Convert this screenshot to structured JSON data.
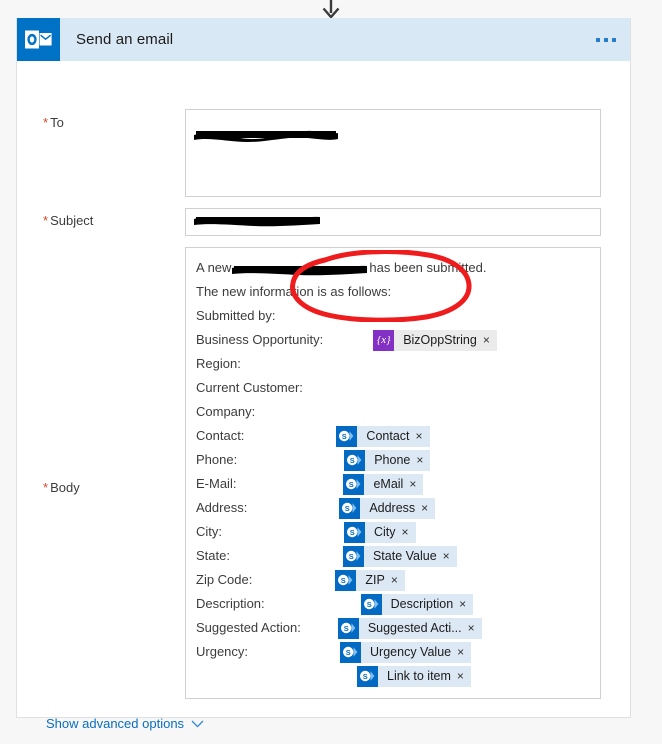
{
  "connector": {
    "icon": "arrow-down-icon"
  },
  "card": {
    "app_icon": "outlook-icon",
    "title": "Send an email",
    "menu_icon": "ellipsis-icon"
  },
  "fields": {
    "to": {
      "label": "To",
      "required": true,
      "value": "",
      "redacted": true
    },
    "subject": {
      "label": "Subject",
      "required": true,
      "value": "",
      "redacted": true
    },
    "body": {
      "label": "Body",
      "required": true
    }
  },
  "body_lines": [
    {
      "type": "text-redacted-text",
      "before": "A new",
      "after": "has been submitted."
    },
    {
      "type": "text",
      "text": "The new information is as follows:"
    },
    {
      "type": "text",
      "text": "Submitted by:"
    },
    {
      "type": "text-token",
      "label": "Business Opportunity:",
      "token": {
        "kind": "variable",
        "icon": "expression-icon",
        "glyph": "{x}",
        "name": "BizOppString",
        "remove": "×"
      },
      "indent": 118
    },
    {
      "type": "text",
      "text": "Region:"
    },
    {
      "type": "text",
      "text": "Current Customer:"
    },
    {
      "type": "text",
      "text": "Company:"
    },
    {
      "type": "text-token",
      "label": "Contact:",
      "token": {
        "kind": "sharepoint",
        "icon": "sharepoint-icon",
        "glyph": "S",
        "name": "Contact",
        "remove": "×"
      },
      "indent": 76
    },
    {
      "type": "text-token",
      "label": "Phone:",
      "token": {
        "kind": "sharepoint",
        "icon": "sharepoint-icon",
        "glyph": "S",
        "name": "Phone",
        "remove": "×"
      },
      "indent": 61
    },
    {
      "type": "text-token",
      "label": "E-Mail:",
      "token": {
        "kind": "sharepoint",
        "icon": "sharepoint-icon",
        "glyph": "S",
        "name": "eMail",
        "remove": "×"
      },
      "indent": 61
    },
    {
      "type": "text-token",
      "label": "Address:",
      "token": {
        "kind": "sharepoint",
        "icon": "sharepoint-icon",
        "glyph": "S",
        "name": "Address",
        "remove": "×"
      },
      "indent": 76
    },
    {
      "type": "text-token",
      "label": "City:",
      "token": {
        "kind": "sharepoint",
        "icon": "sharepoint-icon",
        "glyph": "S",
        "name": "City",
        "remove": "×"
      },
      "indent": 46
    },
    {
      "type": "text-token",
      "label": "State:",
      "token": {
        "kind": "sharepoint",
        "icon": "sharepoint-icon",
        "glyph": "S",
        "name": "State Value",
        "remove": "×"
      },
      "indent": 55
    },
    {
      "type": "text-token",
      "label": "Zip Code:",
      "token": {
        "kind": "sharepoint",
        "icon": "sharepoint-icon",
        "glyph": "S",
        "name": "ZIP",
        "remove": "×"
      },
      "indent": 85
    },
    {
      "type": "text-token",
      "label": "Description:",
      "token": {
        "kind": "sharepoint",
        "icon": "sharepoint-icon",
        "glyph": "S",
        "name": "Description",
        "remove": "×"
      },
      "indent": 72
    },
    {
      "type": "text-token",
      "label": "Suggested Action:",
      "token": {
        "kind": "sharepoint",
        "icon": "sharepoint-icon",
        "glyph": "S",
        "name": "Suggested Acti...",
        "remove": "×"
      },
      "indent": 131
    },
    {
      "type": "text-token",
      "label": "Urgency:",
      "token": {
        "kind": "sharepoint",
        "icon": "sharepoint-icon",
        "glyph": "S",
        "name": "Urgency Value",
        "remove": "×"
      },
      "indent": 76
    },
    {
      "type": "token-only",
      "label": "",
      "token": {
        "kind": "sharepoint",
        "icon": "sharepoint-icon",
        "glyph": "S",
        "name": "Link to item",
        "remove": "×"
      },
      "indent": 7
    }
  ],
  "footer": {
    "advanced_label": "Show advanced options",
    "chevron_icon": "chevron-down-icon"
  },
  "annotation": {
    "shape": "hand-drawn-ellipse",
    "color": "#ee1c1c",
    "targets": "BizOppString"
  },
  "colors": {
    "header_bg": "#d9e8f5",
    "app_icon_bg": "#0072c6",
    "sharepoint_token_bg": "#dce9f5",
    "sharepoint_icon_bg": "#036ac4",
    "variable_token_bg": "#ebebeb",
    "variable_icon_bg": "#8331c4",
    "required_asterisk": "#d24726",
    "link": "#0b6ebe",
    "annotation_red": "#ee1c1c"
  }
}
